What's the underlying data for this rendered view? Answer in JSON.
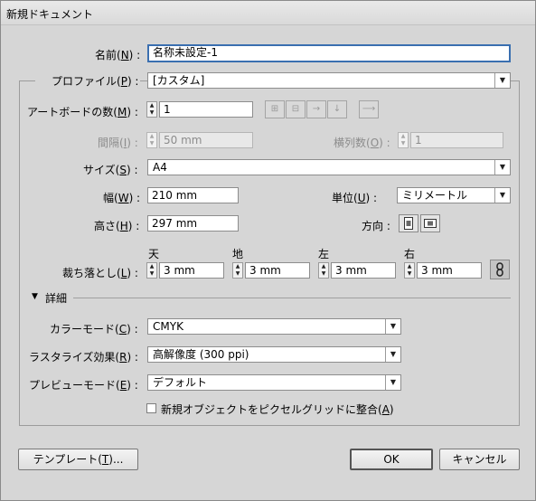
{
  "window": {
    "title": "新規ドキュメント"
  },
  "name": {
    "label_pre": "名前(",
    "key": "N",
    "label_post": ") :",
    "value": "名称未設定-1"
  },
  "profile": {
    "label_pre": "プロファイル(",
    "key": "P",
    "label_post": ") :",
    "value": "[カスタム]"
  },
  "artboards": {
    "label_pre": "アートボードの数(",
    "key": "M",
    "label_post": ") :",
    "value": "1",
    "arrange_icons": [
      "grid-by-row-icon",
      "grid-by-column-icon",
      "arrange-by-row-icon",
      "arrange-by-column-icon",
      "right-to-left-icon"
    ],
    "arrange_glyphs": [
      "⊞",
      "⊟",
      "→",
      "↓",
      "⟶"
    ]
  },
  "spacing": {
    "label_pre": "間隔(",
    "key": "I",
    "label_post": ") :",
    "value": "50 mm"
  },
  "columns": {
    "label_pre": "横列数(",
    "key": "O",
    "label_post": ") :",
    "value": "1"
  },
  "size": {
    "label_pre": "サイズ(",
    "key": "S",
    "label_post": ") :",
    "value": "A4"
  },
  "width": {
    "label_pre": "幅(",
    "key": "W",
    "label_post": ") :",
    "value": "210 mm"
  },
  "units": {
    "label_pre": "単位(",
    "key": "U",
    "label_post": ") :",
    "value": "ミリメートル"
  },
  "height": {
    "label_pre": "高さ(",
    "key": "H",
    "label_post": ") :",
    "value": "297 mm"
  },
  "orientation": {
    "label": "方向 :",
    "portrait_icon": "portrait-icon",
    "landscape_icon": "landscape-icon"
  },
  "bleed": {
    "label_pre": "裁ち落とし(",
    "key": "L",
    "label_post": ") :",
    "top_label": "天",
    "bottom_label": "地",
    "left_label": "左",
    "right_label": "右",
    "top": "3 mm",
    "bottom": "3 mm",
    "left": "3 mm",
    "right": "3 mm",
    "link_icon": "chain-link-icon"
  },
  "advanced": {
    "label": "詳細",
    "toggle": "▼"
  },
  "color_mode": {
    "label_pre": "カラーモード(",
    "key": "C",
    "label_post": ") :",
    "value": "CMYK"
  },
  "raster": {
    "label_pre": "ラスタライズ効果(",
    "key": "R",
    "label_post": ") :",
    "value": "高解像度 (300 ppi)"
  },
  "preview": {
    "label_pre": "プレビューモード(",
    "key": "E",
    "label_post": ") :",
    "value": "デフォルト"
  },
  "align_pixel": {
    "label_pre": "新規オブジェクトをピクセルグリッドに整合(",
    "key": "A",
    "label_post": ")",
    "checked": false
  },
  "buttons": {
    "templates_pre": "テンプレート(",
    "templates_key": "T",
    "templates_post": ")...",
    "ok": "OK",
    "cancel": "キャンセル"
  },
  "colors": {
    "dialog_bg": "#d6d6d6",
    "focus_border": "#3a6fb0"
  }
}
